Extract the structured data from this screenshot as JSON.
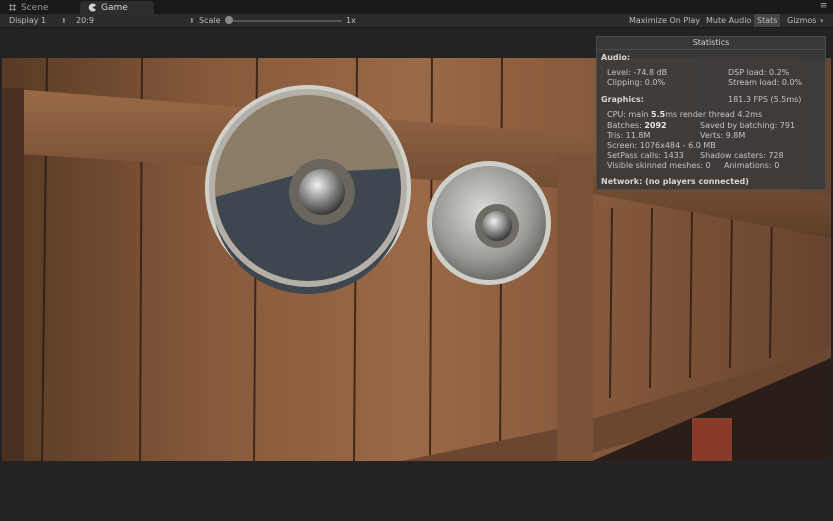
{
  "tabs": [
    {
      "label": "Scene",
      "icon": "grid-icon"
    },
    {
      "label": "Game",
      "icon": "pacman-icon"
    }
  ],
  "toolbar": {
    "display": "Display 1",
    "aspect": "20:9",
    "scale_label": "Scale",
    "scale_value": "1x",
    "scale_level": 0.0,
    "maximize": "Maximize On Play",
    "mute": "Mute Audio",
    "stats": "Stats",
    "gizmos": "Gizmos"
  },
  "stats": {
    "title": "Statistics",
    "audio_header": "Audio:",
    "level": "Level: -74.8 dB",
    "dsp": "DSP load: 0.2%",
    "clipping": "Clipping: 0.0%",
    "stream": "Stream load: 0.0%",
    "graphics_header": "Graphics:",
    "fps": "181.3 FPS (5.5ms)",
    "cpu_prefix": "CPU: main ",
    "cpu_main": "5.5",
    "cpu_suffix": "ms  render thread 4.2ms",
    "batches_prefix": "Batches: ",
    "batches": "2092",
    "saved": "Saved by batching: 791",
    "tris": "Tris: 11.8M",
    "verts": "Verts: 9.8M",
    "screen": "Screen: 1076x484 - 6.0 MB",
    "setpass": "SetPass calls: 1433",
    "shadow": "Shadow casters: 728",
    "skinned": "Visible skinned meshes: 0",
    "anims": "Animations: 0",
    "network": "Network: (no players connected)"
  },
  "colors": {
    "background": "#232323",
    "toolbar": "#2b2b2b",
    "stats_panel": "#3a3a3a"
  }
}
